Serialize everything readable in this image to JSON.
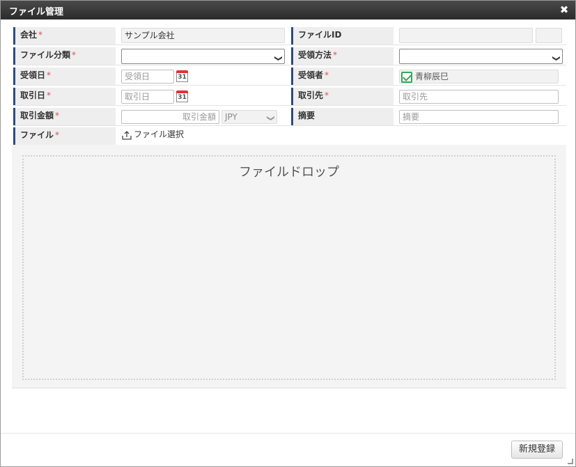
{
  "dialog": {
    "title": "ファイル管理",
    "close_glyph": "✖"
  },
  "form": {
    "company": {
      "label": "会社",
      "required": "*",
      "value": "サンプル会社"
    },
    "file_id": {
      "label": "ファイルID",
      "value": ""
    },
    "file_category": {
      "label": "ファイル分類",
      "required": "*",
      "value": ""
    },
    "receive_method": {
      "label": "受領方法",
      "required": "*",
      "value": ""
    },
    "receive_date": {
      "label": "受領日",
      "required": "*",
      "placeholder": "受領日"
    },
    "receiver": {
      "label": "受領者",
      "required": "*",
      "value": "青柳辰巳",
      "checked": true
    },
    "trade_date": {
      "label": "取引日",
      "required": "*",
      "placeholder": "取引日"
    },
    "trade_partner": {
      "label": "取引先",
      "required": "*",
      "placeholder": "取引先"
    },
    "trade_amount": {
      "label": "取引金額",
      "required": "*",
      "placeholder": "取引金額",
      "currency": "JPY"
    },
    "summary": {
      "label": "摘要",
      "placeholder": "摘要"
    },
    "file": {
      "label": "ファイル",
      "required": "*",
      "select_label": "ファイル選択"
    },
    "calendar_day": "31"
  },
  "dropzone": {
    "text": "ファイルドロップ"
  },
  "footer": {
    "register_button": "新規登録"
  },
  "colors": {
    "accent": "#2c4a8a",
    "required": "#d9534f",
    "check": "#3aa55a"
  }
}
